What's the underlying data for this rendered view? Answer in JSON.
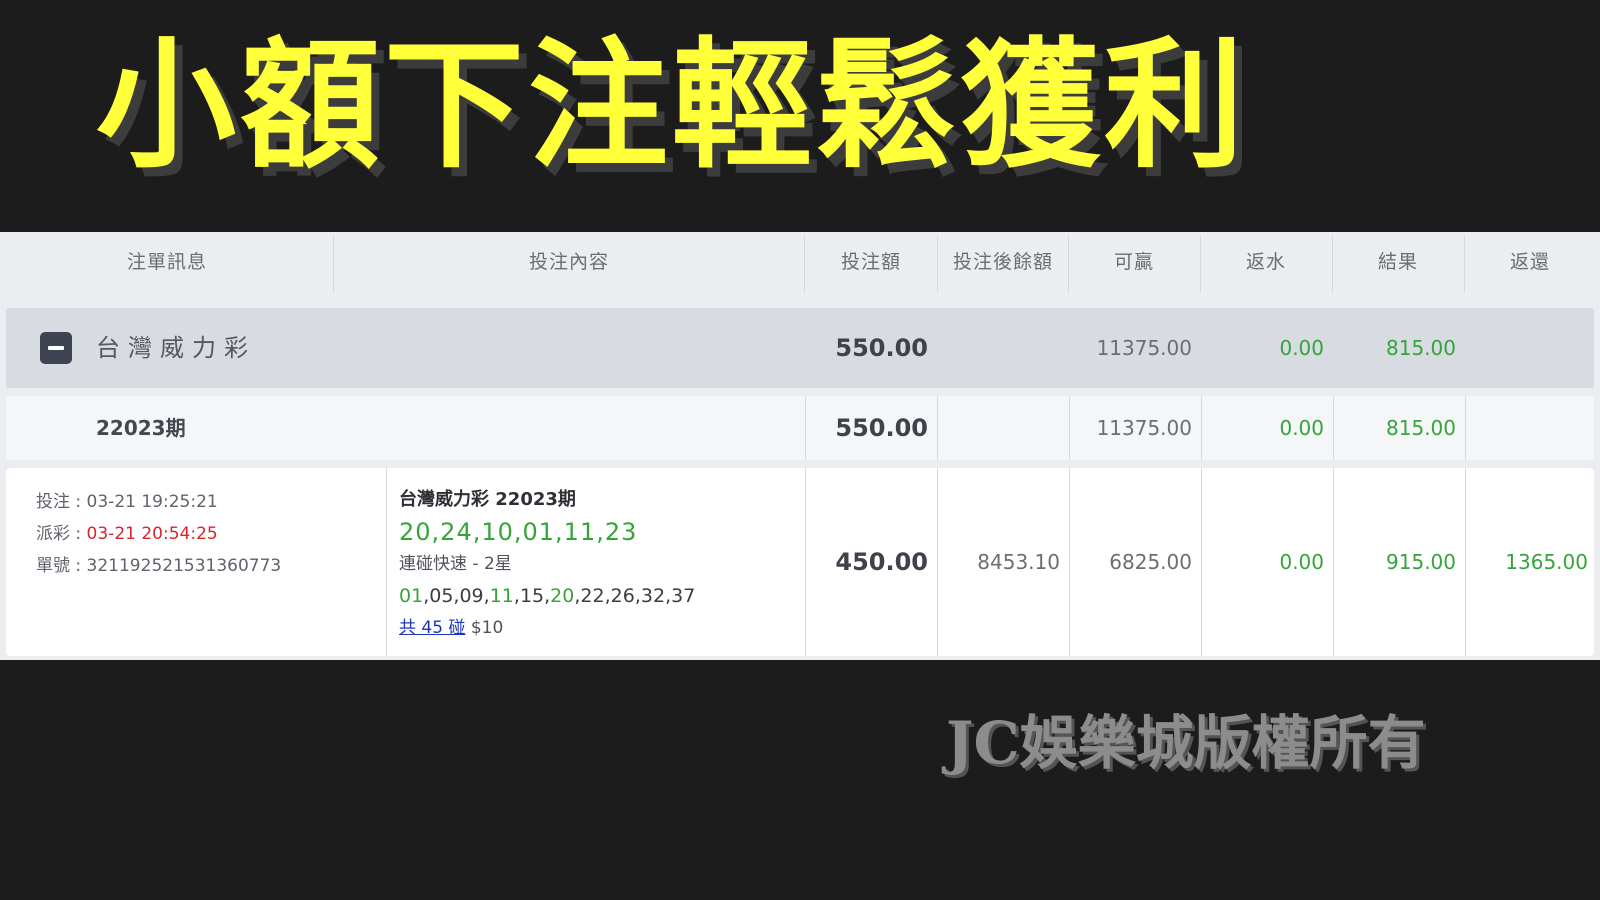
{
  "banner": {
    "title": "小額下注輕鬆獲利"
  },
  "table": {
    "headers": [
      "注單訊息",
      "投注內容",
      "投注額",
      "投注後餘額",
      "可贏",
      "返水",
      "結果",
      "返還"
    ],
    "group": {
      "label": "台灣威力彩",
      "bet_amount": "550.00",
      "balance_after": "",
      "can_win": "11375.00",
      "rebate": "0.00",
      "result": "815.00",
      "returned": ""
    },
    "period": {
      "label": "22023期",
      "bet_amount": "550.00",
      "balance_after": "",
      "can_win": "11375.00",
      "rebate": "0.00",
      "result": "815.00",
      "returned": ""
    },
    "detail": {
      "bet_time_label": "投注 : ",
      "bet_time": "03-21 19:25:21",
      "payout_time_label": "派彩 : ",
      "payout_time": "03-21 20:54:25",
      "order_no_label": "單號 : ",
      "order_no": "321192521531360773",
      "game_title": "台灣威力彩 22023期",
      "draw_numbers": "20,24,10,01,11,23",
      "play_type": "連碰快速 - 2星",
      "picked_numbers": [
        {
          "n": "01",
          "hit": true
        },
        {
          "n": "05",
          "hit": false
        },
        {
          "n": "09",
          "hit": false
        },
        {
          "n": "11",
          "hit": true
        },
        {
          "n": "15",
          "hit": false
        },
        {
          "n": "20",
          "hit": true
        },
        {
          "n": "22",
          "hit": false
        },
        {
          "n": "26",
          "hit": false
        },
        {
          "n": "32",
          "hit": false
        },
        {
          "n": "37",
          "hit": false
        }
      ],
      "combo_link": "共 45 碰",
      "unit_price": "$10",
      "bet_amount": "450.00",
      "balance_after": "8453.10",
      "can_win": "6825.00",
      "rebate": "0.00",
      "result": "915.00",
      "returned": "1365.00"
    },
    "colors": {
      "win_green": "#35a53a",
      "payout_red": "#d9252c",
      "link_blue": "#1e36b8"
    }
  },
  "watermark": {
    "text": "JC娛樂城版權所有"
  }
}
